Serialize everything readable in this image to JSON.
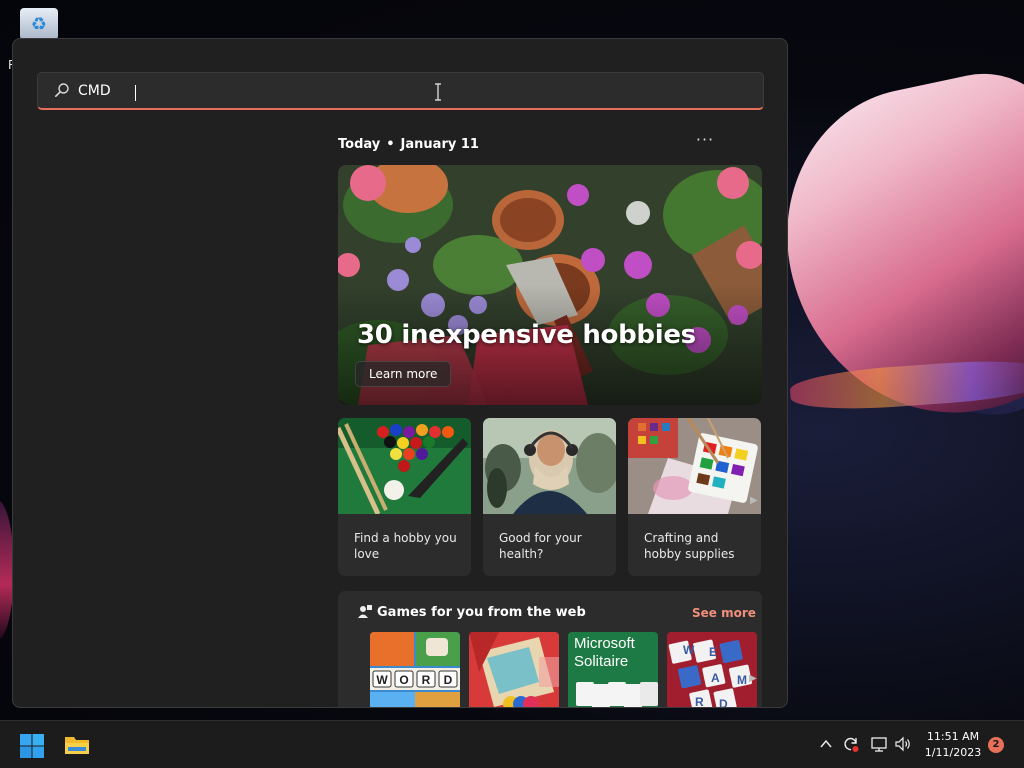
{
  "desktop": {
    "recycle_bin_label": "R",
    "recycle_icon": "recycle-icon"
  },
  "search": {
    "value": "CMD",
    "icon": "search-icon"
  },
  "feed": {
    "today_label": "Today",
    "date": "January 11",
    "more_icon": "more-dots-icon",
    "hero": {
      "title": "30 inexpensive hobbies",
      "button": "Learn more"
    },
    "cards": [
      {
        "label": "Find a hobby you love",
        "image": "billiards"
      },
      {
        "label": "Good for your health?",
        "image": "woman-headphones"
      },
      {
        "label": "Crafting and hobby supplies",
        "image": "watercolor-paints"
      }
    ],
    "games": {
      "title": "Games for you from the web",
      "see_more": "See more",
      "tiles": [
        {
          "name": "word-game"
        },
        {
          "name": "puzzle-game"
        },
        {
          "name": "Microsoft Solitaire",
          "line1": "Microsoft",
          "line2": "Solitaire"
        },
        {
          "name": "word-tiles-game"
        }
      ]
    }
  },
  "taskbar": {
    "time": "11:51 AM",
    "date": "1/11/2023",
    "notification_count": "2",
    "accent": "#e8705a"
  }
}
